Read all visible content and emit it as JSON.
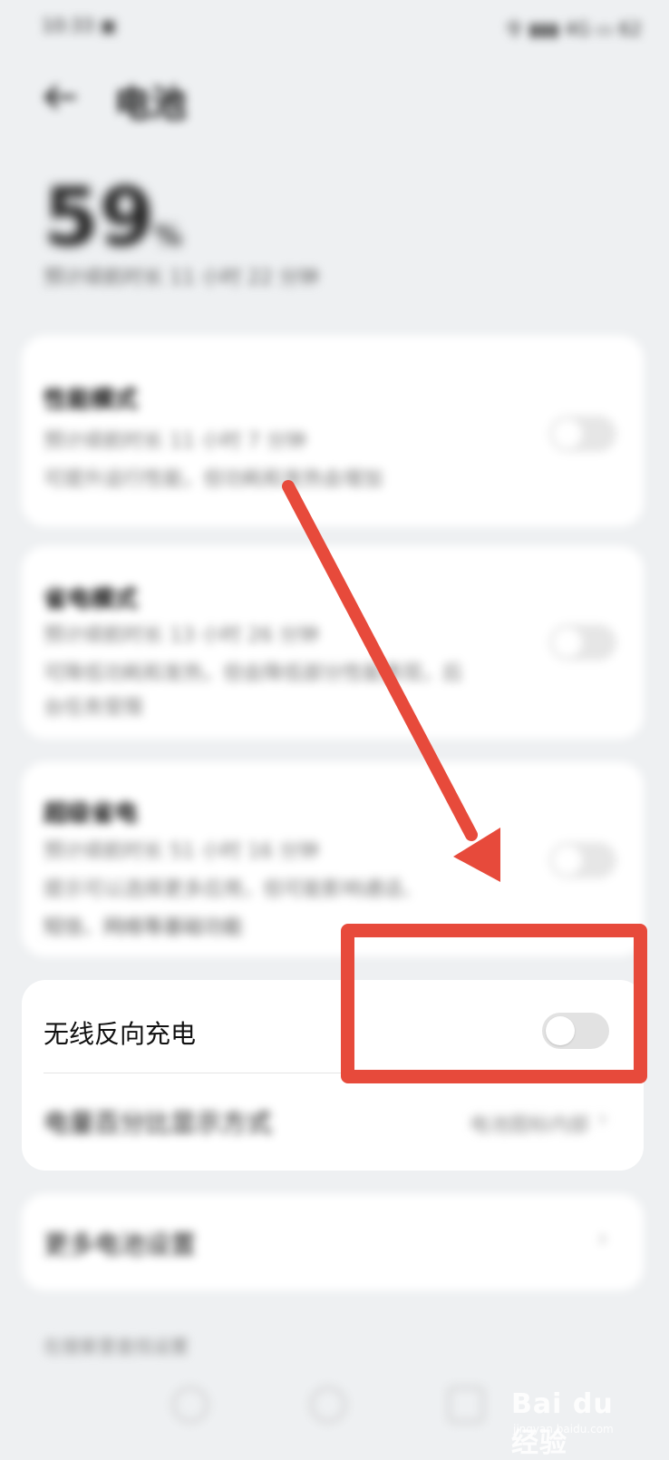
{
  "status_bar": {
    "time": "10:33 ▣",
    "right": "令 ▮▮▮ 4G ▭ 62"
  },
  "header": {
    "title": "电池",
    "back_icon": "back-arrow-icon"
  },
  "battery": {
    "percent": "59",
    "unit": "%",
    "subtitle": "预计续航时长 11 小时 22 分钟"
  },
  "modes": [
    {
      "title": "性能模式",
      "line1": "预计续航时长 11 小时 7 分钟",
      "line2": "可提升运行性能，但功耗和发热会增加",
      "line3": "",
      "enabled": false
    },
    {
      "title": "省电模式",
      "line1": "预计续航时长 13 小时 26 分钟",
      "line2": "可降低功耗和发热，但会降低部分性能表现，后",
      "line3": "台任务受限",
      "enabled": false
    },
    {
      "title": "超级省电",
      "line1": "预计续航时长 51 小时 16 分钟",
      "line2": "提示可以选择更多应用，但可能影响通话、",
      "line3": "短信、网络等基础功能",
      "enabled": false
    }
  ],
  "settings": {
    "wireless_reverse": {
      "label": "无线反向充电",
      "enabled": false
    },
    "display_battery": {
      "label": "电量百分比显示方式",
      "value": "电池图标内部"
    },
    "more": {
      "label": "更多电池设置"
    }
  },
  "footer_text": "在搜索里查找设置",
  "annotation": {
    "color": "#e74a3b"
  },
  "watermark": {
    "brand": "Bai du 经验",
    "url": "jingyan.baidu.com"
  }
}
